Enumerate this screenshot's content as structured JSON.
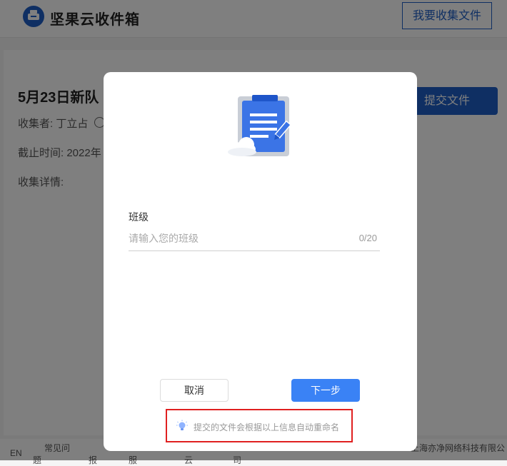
{
  "header": {
    "brand": "坚果云收件箱",
    "collect_button": "我要收集文件"
  },
  "task": {
    "title": "5月23日新队",
    "collector": "收集者:  丁立占",
    "deadline": "截止时间:  2022年",
    "detail": "收集详情:",
    "submit_button": "提交文件"
  },
  "footer": {
    "lang": "EN",
    "faq": "常见问",
    "faq2": "题",
    "f3": "报",
    "f4": "服",
    "f5": "云",
    "f6": "司",
    "company": "上海亦净网络科技有限公"
  },
  "modal": {
    "field_label": "班级",
    "input_value": "",
    "input_placeholder": "请输入您的班级",
    "counter": "0/20",
    "cancel_button": "取消",
    "next_button": "下一步",
    "tip": "提交的文件会根据以上信息自动重命名"
  },
  "colors": {
    "brand_blue": "#1e5fc7",
    "primary_button": "#3a82f5",
    "highlight_border": "#e02020"
  },
  "icons": [
    "inbox-logo-icon",
    "clipboard-cloud-illustration",
    "lightbulb-icon",
    "help-circle-icon"
  ]
}
